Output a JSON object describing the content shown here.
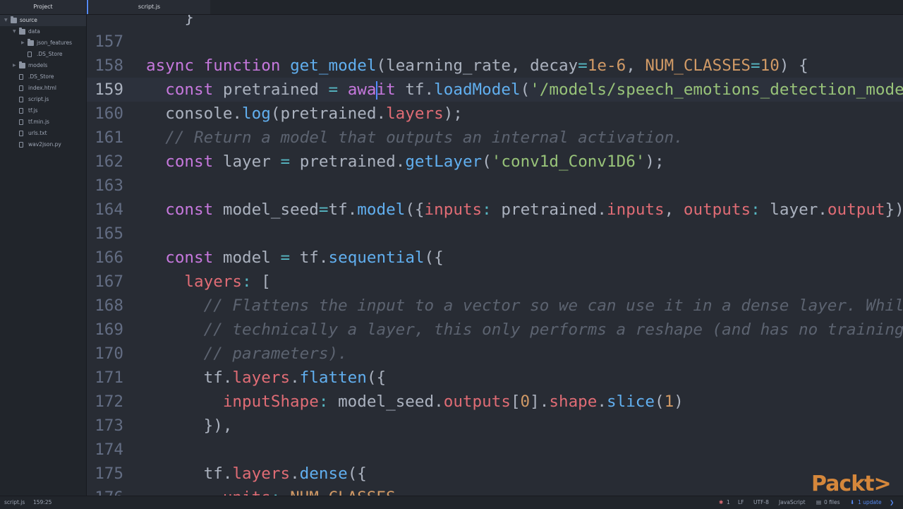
{
  "sidebar": {
    "title": "Project",
    "tree": [
      {
        "label": "source",
        "type": "folder",
        "depth": 0,
        "expanded": true,
        "selected": true
      },
      {
        "label": "data",
        "type": "folder",
        "depth": 1,
        "expanded": true
      },
      {
        "label": "json_features",
        "type": "folder",
        "depth": 2,
        "expanded": false
      },
      {
        "label": ".DS_Store",
        "type": "file",
        "depth": 2
      },
      {
        "label": "models",
        "type": "folder",
        "depth": 1,
        "expanded": false
      },
      {
        "label": ".DS_Store",
        "type": "file",
        "depth": 1
      },
      {
        "label": "index.html",
        "type": "file",
        "depth": 1
      },
      {
        "label": "script.js",
        "type": "file",
        "depth": 1
      },
      {
        "label": "tf.js",
        "type": "file",
        "depth": 1
      },
      {
        "label": "tf.min.js",
        "type": "file",
        "depth": 1
      },
      {
        "label": "urls.txt",
        "type": "file",
        "depth": 1
      },
      {
        "label": "wav2json.py",
        "type": "file",
        "depth": 1
      }
    ]
  },
  "tabs": [
    {
      "label": "script.js",
      "active": true
    }
  ],
  "editor": {
    "lines": [
      {
        "num": "",
        "tokens": [
          [
            "pl",
            "    }"
          ]
        ]
      },
      {
        "num": "157",
        "tokens": []
      },
      {
        "num": "158",
        "tokens": [
          [
            "kw",
            "async "
          ],
          [
            "kw",
            "function "
          ],
          [
            "fn",
            "get_model"
          ],
          [
            "pl",
            "(learning_rate, decay"
          ],
          [
            "op",
            "="
          ],
          [
            "num",
            "1e-6"
          ],
          [
            "pl",
            ", "
          ],
          [
            "num",
            "NUM_CLASSES"
          ],
          [
            "op",
            "="
          ],
          [
            "num",
            "10"
          ],
          [
            "pl",
            ") {"
          ]
        ]
      },
      {
        "num": "159",
        "current": true,
        "tokens": [
          [
            "pl",
            "  "
          ],
          [
            "kw",
            "const "
          ],
          [
            "pl",
            "pretrained "
          ],
          [
            "op",
            "= "
          ],
          [
            "kw",
            "awa"
          ],
          [
            "cursor",
            ""
          ],
          [
            "kw",
            "it "
          ],
          [
            "pl",
            "tf."
          ],
          [
            "fn",
            "loadModel"
          ],
          [
            "pl",
            "("
          ],
          [
            "str",
            "'/models/speech_emotions_detection_model"
          ]
        ]
      },
      {
        "num": "160",
        "tokens": [
          [
            "pl",
            "  console."
          ],
          [
            "fn",
            "log"
          ],
          [
            "pl",
            "(pretrained."
          ],
          [
            "prop",
            "layers"
          ],
          [
            "pl",
            ");"
          ]
        ]
      },
      {
        "num": "161",
        "tokens": [
          [
            "pl",
            "  "
          ],
          [
            "cm",
            "// Return a model that outputs an internal activation."
          ]
        ]
      },
      {
        "num": "162",
        "tokens": [
          [
            "pl",
            "  "
          ],
          [
            "kw",
            "const "
          ],
          [
            "pl",
            "layer "
          ],
          [
            "op",
            "= "
          ],
          [
            "pl",
            "pretrained."
          ],
          [
            "fn",
            "getLayer"
          ],
          [
            "pl",
            "("
          ],
          [
            "str",
            "'conv1d_Conv1D6'"
          ],
          [
            "pl",
            ");"
          ]
        ]
      },
      {
        "num": "163",
        "tokens": []
      },
      {
        "num": "164",
        "tokens": [
          [
            "pl",
            "  "
          ],
          [
            "kw",
            "const "
          ],
          [
            "pl",
            "model_seed"
          ],
          [
            "op",
            "="
          ],
          [
            "pl",
            "tf."
          ],
          [
            "fn",
            "model"
          ],
          [
            "pl",
            "({"
          ],
          [
            "prop",
            "inputs"
          ],
          [
            "op",
            ": "
          ],
          [
            "pl",
            "pretrained."
          ],
          [
            "prop",
            "inputs"
          ],
          [
            "pl",
            ", "
          ],
          [
            "prop",
            "outputs"
          ],
          [
            "op",
            ": "
          ],
          [
            "pl",
            "layer."
          ],
          [
            "prop",
            "output"
          ],
          [
            "pl",
            "});"
          ]
        ]
      },
      {
        "num": "165",
        "tokens": []
      },
      {
        "num": "166",
        "tokens": [
          [
            "pl",
            "  "
          ],
          [
            "kw",
            "const "
          ],
          [
            "pl",
            "model "
          ],
          [
            "op",
            "= "
          ],
          [
            "pl",
            "tf."
          ],
          [
            "fn",
            "sequential"
          ],
          [
            "pl",
            "({"
          ]
        ]
      },
      {
        "num": "167",
        "tokens": [
          [
            "pl",
            "    "
          ],
          [
            "prop",
            "layers"
          ],
          [
            "op",
            ": "
          ],
          [
            "pl",
            "["
          ]
        ]
      },
      {
        "num": "168",
        "tokens": [
          [
            "pl",
            "      "
          ],
          [
            "cm",
            "// Flattens the input to a vector so we can use it in a dense layer. While"
          ]
        ]
      },
      {
        "num": "169",
        "tokens": [
          [
            "pl",
            "      "
          ],
          [
            "cm",
            "// technically a layer, this only performs a reshape (and has no training"
          ]
        ]
      },
      {
        "num": "170",
        "tokens": [
          [
            "pl",
            "      "
          ],
          [
            "cm",
            "// parameters)."
          ]
        ]
      },
      {
        "num": "171",
        "tokens": [
          [
            "pl",
            "      tf."
          ],
          [
            "prop",
            "layers"
          ],
          [
            "pl",
            "."
          ],
          [
            "fn",
            "flatten"
          ],
          [
            "pl",
            "({"
          ]
        ]
      },
      {
        "num": "172",
        "tokens": [
          [
            "pl",
            "        "
          ],
          [
            "prop",
            "inputShape"
          ],
          [
            "op",
            ": "
          ],
          [
            "pl",
            "model_seed."
          ],
          [
            "prop",
            "outputs"
          ],
          [
            "pl",
            "["
          ],
          [
            "num",
            "0"
          ],
          [
            "pl",
            "]."
          ],
          [
            "prop",
            "shape"
          ],
          [
            "pl",
            "."
          ],
          [
            "fn",
            "slice"
          ],
          [
            "pl",
            "("
          ],
          [
            "num",
            "1"
          ],
          [
            "pl",
            ")"
          ]
        ]
      },
      {
        "num": "173",
        "tokens": [
          [
            "pl",
            "      }),"
          ]
        ]
      },
      {
        "num": "174",
        "tokens": []
      },
      {
        "num": "175",
        "tokens": [
          [
            "pl",
            "      tf."
          ],
          [
            "prop",
            "layers"
          ],
          [
            "pl",
            "."
          ],
          [
            "fn",
            "dense"
          ],
          [
            "pl",
            "({"
          ]
        ]
      },
      {
        "num": "176",
        "tokens": [
          [
            "pl",
            "        "
          ],
          [
            "prop",
            "units"
          ],
          [
            "op",
            ": "
          ],
          [
            "num",
            "NUM_CLASSES"
          ],
          [
            "pl",
            ","
          ]
        ]
      }
    ]
  },
  "status": {
    "file": "script.js",
    "position": "159:25",
    "bug_count": "1",
    "line_ending": "LF",
    "encoding": "UTF-8",
    "grammar": "JavaScript",
    "git": "0 files",
    "update": "1 update"
  },
  "logo": "Packt>",
  "colors": {
    "accent": "#568af2",
    "logo": "#e8913c"
  }
}
